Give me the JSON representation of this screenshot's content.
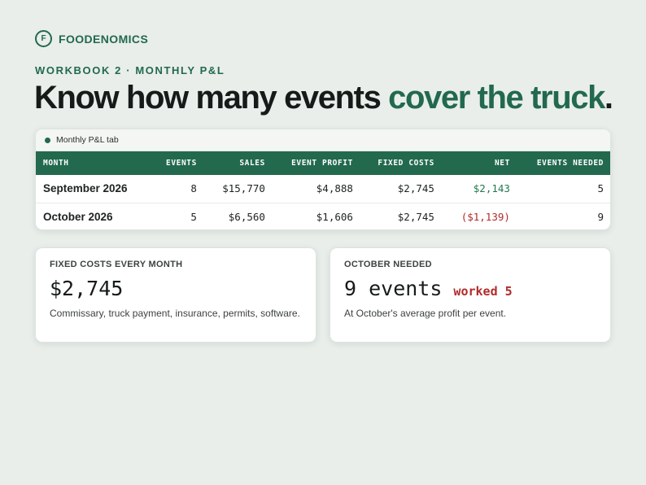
{
  "brand": {
    "mark": "F",
    "name": "FOODENOMICS"
  },
  "eyebrow": "WORKBOOK 2 · MONTHLY P&L",
  "headline": {
    "main": "Know how many events ",
    "accent": "cover the truck",
    "end": "."
  },
  "table": {
    "tab_label": "Monthly P&L tab",
    "headers": [
      "MONTH",
      "EVENTS",
      "SALES",
      "EVENT PROFIT",
      "FIXED COSTS",
      "NET",
      "EVENTS NEEDED"
    ],
    "rows": [
      {
        "month": "September 2026",
        "events": "8",
        "sales": "$15,770",
        "event_profit": "$4,888",
        "fixed_costs": "$2,745",
        "net": "$2,143",
        "events_needed": "5"
      },
      {
        "month": "October 2026",
        "events": "5",
        "sales": "$6,560",
        "event_profit": "$1,606",
        "fixed_costs": "$2,745",
        "net": "($1,139)",
        "events_needed": "9"
      }
    ]
  },
  "fixed_card": {
    "label": "FIXED COSTS EVERY MONTH",
    "value": "$2,745",
    "note": "Commissary, truck payment, insurance, permits, software."
  },
  "needed_card": {
    "label": "OCTOBER NEEDED",
    "value": "9 events",
    "worked": "worked 5",
    "note": "At October's average profit per event."
  },
  "colors": {
    "brand_green": "#22694e",
    "positive": "#22794f",
    "negative": "#b02b2b",
    "background": "#e9eeea"
  }
}
